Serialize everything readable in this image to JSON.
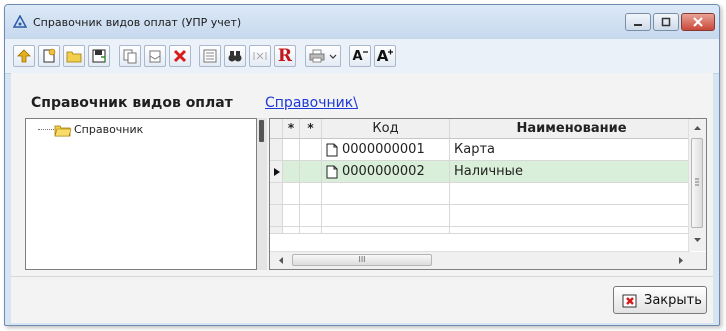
{
  "window": {
    "title": "Справочник видов оплат (УПР учет)",
    "controls": [
      "minimize",
      "maximize",
      "close"
    ]
  },
  "toolbar": {
    "buttons": [
      {
        "icon": "go-up-icon"
      },
      {
        "icon": "new-folder-icon"
      },
      {
        "icon": "folder-icon"
      },
      {
        "icon": "save-icon"
      },
      {
        "icon": "copy-icon"
      },
      {
        "icon": "paste-icon"
      },
      {
        "icon": "delete-icon"
      },
      {
        "icon": "list-icon"
      },
      {
        "icon": "binoculars-icon"
      },
      {
        "icon": "filter-icon"
      },
      {
        "icon": "R",
        "label": "R"
      },
      {
        "icon": "printer-icon"
      },
      {
        "icon": "font-decrease-icon",
        "label": "A"
      },
      {
        "icon": "font-increase-icon",
        "label": "A"
      }
    ]
  },
  "heading": {
    "title": "Справочник видов оплат",
    "breadcrumb": "Справочник\\"
  },
  "tree": {
    "items": [
      {
        "label": "Справочник"
      }
    ]
  },
  "grid": {
    "columns": {
      "mark1": "*",
      "mark2": "*",
      "code": "Код",
      "name": "Наименование"
    },
    "rows": [
      {
        "code": "0000000001",
        "name": "Карта"
      },
      {
        "code": "0000000002",
        "name": "Наличные",
        "selected": true
      }
    ],
    "hscroll_grip": "III"
  },
  "footer": {
    "close_label": "Закрыть"
  }
}
